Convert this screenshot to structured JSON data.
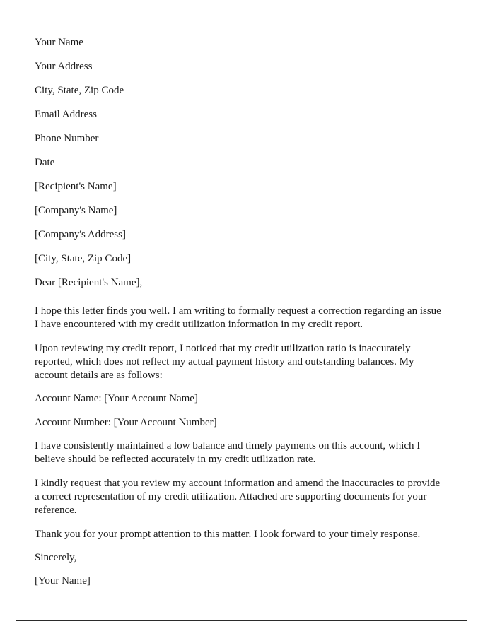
{
  "document": {
    "type": "formal-letter",
    "border_color": "#2b2b2b",
    "background_color": "#ffffff",
    "text_color": "#1a1a1a",
    "sender_block": [
      {
        "label": "Your Name"
      },
      {
        "label": "Your Address"
      },
      {
        "label": "City, State, Zip Code"
      },
      {
        "label": "Email Address"
      },
      {
        "label": "Phone Number"
      },
      {
        "label": "Date"
      }
    ],
    "recipient_block": [
      {
        "label": "[Recipient's Name]"
      },
      {
        "label": "[Company's Name]"
      },
      {
        "label": "[Company's Address]"
      },
      {
        "label": "[City, State, Zip Code]"
      }
    ],
    "salutation": "Dear [Recipient's Name],",
    "paragraphs": [
      {
        "text": "I hope this letter finds you well. I am writing to formally request a correction regarding an issue I have encountered with my credit utilization information in my credit report."
      },
      {
        "text": "Upon reviewing my credit report, I noticed that my credit utilization ratio is inaccurately reported, which does not reflect my actual payment history and outstanding balances. My account details are as follows:"
      }
    ],
    "account_details": [
      {
        "text": "Account Name: [Your Account Name]"
      },
      {
        "text": "Account Number: [Your Account Number]"
      }
    ],
    "paragraphs_after_details": [
      {
        "text": "I have consistently maintained a low balance and timely payments on this account, which I believe should be reflected accurately in my credit utilization rate."
      },
      {
        "text": "I kindly request that you review my account information and amend the inaccuracies to provide a correct representation of my credit utilization. Attached are supporting documents for your reference."
      },
      {
        "text": "Thank you for your prompt attention to this matter. I look forward to your timely response."
      }
    ],
    "closing": "Sincerely,",
    "signature": "[Your Name]"
  }
}
